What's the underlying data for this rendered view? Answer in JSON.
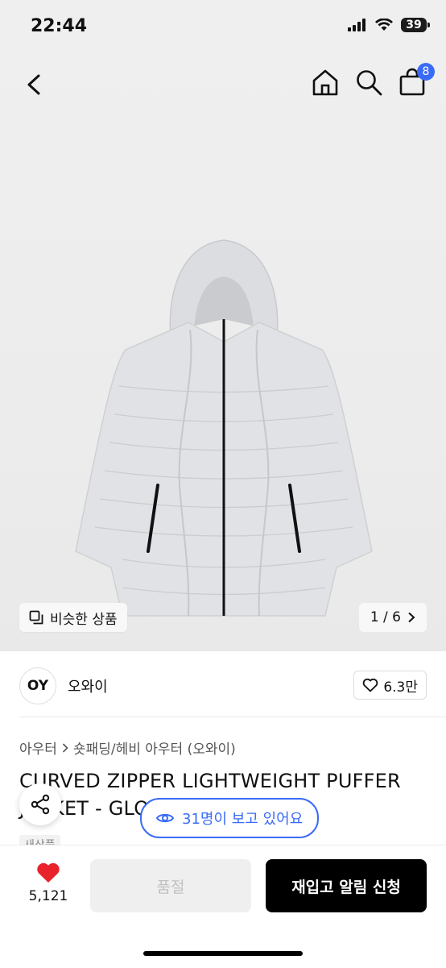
{
  "status_bar": {
    "time": "22:44",
    "battery": "39"
  },
  "header": {
    "cart_count": "8"
  },
  "gallery": {
    "similar_label": "비슷한 상품",
    "pager": "1 / 6"
  },
  "brand": {
    "logo_text": "OY",
    "name": "오와이",
    "likes": "6.3만"
  },
  "breadcrumb": {
    "level1": "아우터",
    "level2": "숏패딩/헤비 아우터 (오와이)"
  },
  "product": {
    "title": "CURVED ZIPPER LIGHTWEIGHT PUFFER JACKET - GLOSSY GRAY",
    "condition_badge": "새상품"
  },
  "overlay": {
    "viewers": "31명이 보고 있어요"
  },
  "bottom": {
    "wish_count": "5,121",
    "soldout_label": "품절",
    "restock_label": "재입고 알림 신청"
  },
  "colors": {
    "accent": "#3b6bf6",
    "heart": "#e8232c",
    "primary_button": "#000000"
  }
}
